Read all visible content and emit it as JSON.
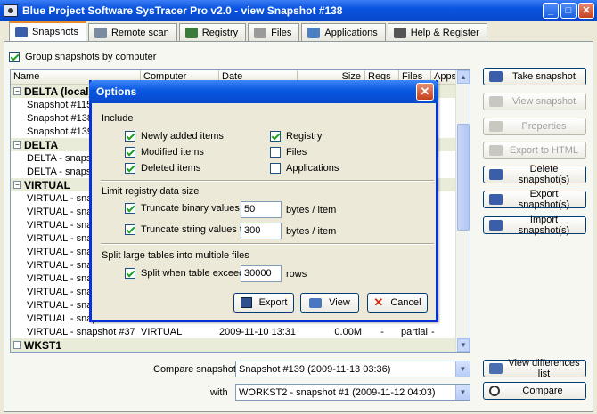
{
  "window": {
    "title": "Blue Project Software SysTracer Pro v2.0 - view Snapshot #138",
    "min": "_",
    "max": "□",
    "close": "✕"
  },
  "tabs": [
    {
      "label": "Snapshots",
      "color": "#3a5fa8"
    },
    {
      "label": "Remote scan",
      "color": "#7a8aa0"
    },
    {
      "label": "Registry",
      "color": "#3c7a3c"
    },
    {
      "label": "Files",
      "color": "#9a9a9a"
    },
    {
      "label": "Applications",
      "color": "#4a7fc2"
    },
    {
      "label": "Help & Register",
      "color": "#555555"
    }
  ],
  "group_label": "Group snapshots by computer",
  "columns": [
    "Name",
    "Computer",
    "Date",
    "Size",
    "Regs",
    "Files",
    "Apps"
  ],
  "groups": [
    {
      "name": "DELTA (local)",
      "expander": "−",
      "rows": [
        {
          "name": "Snapshot #115"
        },
        {
          "name": "Snapshot #138"
        },
        {
          "name": "Snapshot #139"
        }
      ]
    },
    {
      "name": "DELTA",
      "expander": "−",
      "rows": [
        {
          "name": "DELTA - snapshot"
        },
        {
          "name": "DELTA - snapshot"
        }
      ]
    },
    {
      "name": "VIRTUAL",
      "expander": "−",
      "rows": [
        {
          "name": "VIRTUAL - snapsh"
        },
        {
          "name": "VIRTUAL - snapsh"
        },
        {
          "name": "VIRTUAL - snapsh"
        },
        {
          "name": "VIRTUAL - snapsh"
        },
        {
          "name": "VIRTUAL - snapsh"
        },
        {
          "name": "VIRTUAL - snapsh"
        },
        {
          "name": "VIRTUAL - snapsh"
        },
        {
          "name": "VIRTUAL - snapsh"
        },
        {
          "name": "VIRTUAL - snapsh"
        },
        {
          "name": "VIRTUAL - snapsh"
        },
        {
          "name": "VIRTUAL - snapshot #37",
          "computer": "VIRTUAL",
          "date": "2009-11-10 13:31",
          "size": "0.00M",
          "regs": "-",
          "files": "partial",
          "apps": "-"
        }
      ]
    },
    {
      "name": "WKST1",
      "expander": "−",
      "rows": []
    }
  ],
  "buttons": [
    {
      "label": "Take snapshot",
      "enabled": true
    },
    {
      "label": "View snapshot",
      "enabled": false
    },
    {
      "label": "Properties",
      "enabled": false
    },
    {
      "label": "Export to HTML",
      "enabled": false
    },
    {
      "label": "Delete snapshot(s)",
      "enabled": true
    },
    {
      "label": "Export snapshot(s)",
      "enabled": true
    },
    {
      "label": "Import snapshot(s)",
      "enabled": true
    }
  ],
  "compare": {
    "label": "Compare snapshot",
    "value": "Snapshot #139 (2009-11-13 03:36)",
    "with_label": "with",
    "with_value": "WORKST2 - snapshot #1 (2009-11-12 04:03)",
    "view_diff": "View differences list",
    "compare_btn": "Compare"
  },
  "dialog": {
    "title": "Options",
    "close": "✕",
    "include": "Include",
    "checks_left": [
      {
        "label": "Newly added items",
        "checked": true
      },
      {
        "label": "Modified items",
        "checked": true
      },
      {
        "label": "Deleted items",
        "checked": true
      }
    ],
    "checks_right": [
      {
        "label": "Registry",
        "checked": true
      },
      {
        "label": "Files",
        "checked": false
      },
      {
        "label": "Applications",
        "checked": false
      }
    ],
    "limit_label": "Limit registry data size",
    "trunc_bin": {
      "label": "Truncate binary values to",
      "value": "50",
      "unit": "bytes / item"
    },
    "trunc_str": {
      "label": "Truncate string values to",
      "value": "300",
      "unit": "bytes / item"
    },
    "split_label": "Split large tables into multiple files",
    "split": {
      "label": "Split when table exceeds",
      "value": "30000",
      "unit": "rows"
    },
    "export": "Export",
    "view": "View",
    "cancel": "Cancel"
  }
}
